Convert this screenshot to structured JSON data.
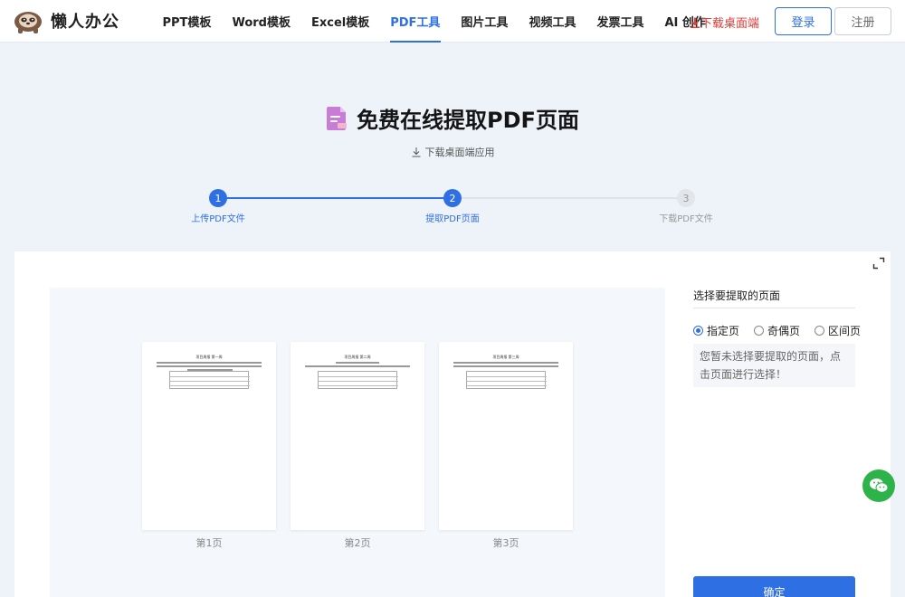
{
  "header": {
    "brand": "懒人办公",
    "nav": [
      "PPT模板",
      "Word模板",
      "Excel模板",
      "PDF工具",
      "图片工具",
      "视频工具",
      "发票工具",
      "AI 创作"
    ],
    "active_nav": "PDF工具",
    "download_label": "下载桌面端",
    "login_label": "登录",
    "register_label": "注册"
  },
  "main": {
    "title": "免费在线提取PDF页面",
    "download_app_label": "下载桌面端应用"
  },
  "steps": [
    {
      "number": "1",
      "label": "上传PDF文件",
      "state": "done"
    },
    {
      "number": "2",
      "label": "提取PDF页面",
      "state": "active"
    },
    {
      "number": "3",
      "label": "下载PDF文件",
      "state": "pending"
    }
  ],
  "pages": [
    {
      "label": "第1页",
      "doc_title": "项目周报 第一周"
    },
    {
      "label": "第2页",
      "doc_title": "项目周报 第二周"
    },
    {
      "label": "第3页",
      "doc_title": "项目周报 第三周"
    }
  ],
  "sidebar": {
    "title": "选择要提取的页面",
    "options": [
      "指定页",
      "奇偶页",
      "区间页"
    ],
    "selected": "指定页",
    "hint": "您暂未选择要提取的页面，点击页面进行选择！",
    "confirm_label": "确定"
  },
  "colors": {
    "accent": "#2f6fe4",
    "download_red": "#e53935",
    "wechat_green": "#2eb24a",
    "background": "#eef3f9"
  },
  "icons": [
    "sloth-logo-icon",
    "download-icon",
    "pdf-file-icon",
    "expand-icon",
    "wechat-icon"
  ]
}
